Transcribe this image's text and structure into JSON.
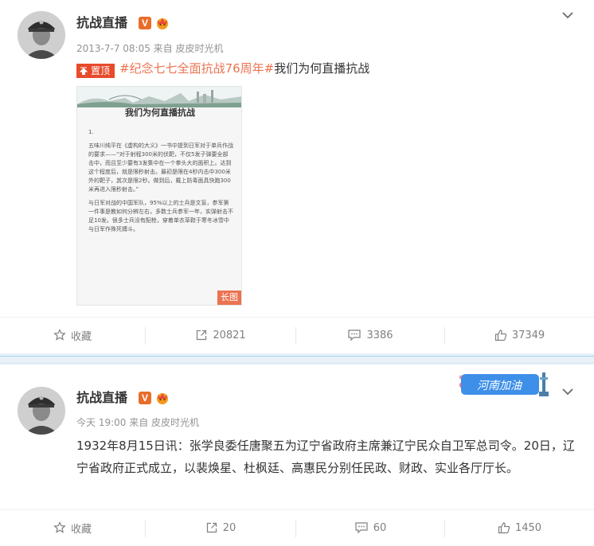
{
  "post1": {
    "author": "抗战直播",
    "verified": "V",
    "meta": "2013-7-7 08:05 来自 皮皮时光机",
    "pinned_label": "置顶",
    "topic": "#纪念七七全面抗战76周年#",
    "text": "我们为何直播抗战",
    "image": {
      "title": "我们为何直播抗战",
      "num": "1.",
      "para1": "五味川纯平在《虚构的大义》一书中提到日军对于单兵作战的要求——“对于射程300米的伏靶，不仅5发子弹要全部击中，而且至少要有3发集中在一个拳头大的面积上。达到这个程度后，就是限秒射击。最初是限在4秒内击中300米外的靶子，其次是限2秒。做到后，戴上防毒面具快跑300米再进入限秒射击。”",
      "para2": "与日军对战的中国军队，95%以上的士兵是文盲，参军第一件事是教如何分辨左右，多数士兵参军一年，实弹射击不足10发。很多士兵没有配枪，穿着单衣草鞋于寒冬冰雪中与日军作殊死搏斗。",
      "badge": "长图"
    },
    "actions": {
      "favorite": "收藏",
      "repost": "20821",
      "comment": "3386",
      "like": "37349"
    }
  },
  "post2": {
    "author": "抗战直播",
    "verified": "V",
    "meta": "今天 19:00 来自 皮皮时光机",
    "text": "1932年8月15日讯：张学良委任唐聚五为辽宁省政府主席兼辽宁民众自卫军总司令。20日，辽宁省政府正式成立，以裴焕星、杜枫廷、高惠民分别任民政、财政、实业各厅厅长。",
    "decoration": "河南加油",
    "actions": {
      "favorite": "收藏",
      "repost": "20",
      "comment": "60",
      "like": "1450"
    }
  },
  "colors": {
    "accent": "#eb7350",
    "pin": "#e74b2c",
    "meta": "#939393",
    "divider": "#e9f0f7"
  }
}
